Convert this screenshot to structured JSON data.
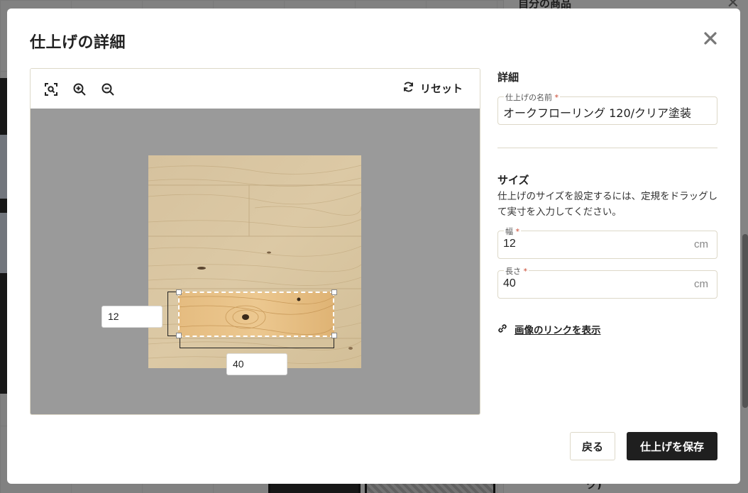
{
  "background": {
    "panel_title": "自分の商品",
    "fragment_text": "ク)"
  },
  "modal": {
    "title": "仕上げの詳細",
    "close_icon": "close-icon"
  },
  "editor": {
    "tools": [
      "fit-to-screen-icon",
      "zoom-in-icon",
      "zoom-out-icon"
    ],
    "reset_label": "リセット",
    "width_value": "12",
    "length_value": "40"
  },
  "details": {
    "heading": "詳細",
    "name_label": "仕上げの名前",
    "name_required": "*",
    "name_value": "オークフローリング 120/クリア塗装"
  },
  "size": {
    "heading": "サイズ",
    "help_text": "仕上げのサイズを設定するには、定規をドラッグして実寸を入力してください。",
    "width_label": "幅",
    "width_required": "*",
    "width_value": "12",
    "width_unit": "cm",
    "length_label": "長さ",
    "length_required": "*",
    "length_value": "40",
    "length_unit": "cm"
  },
  "link": {
    "icon": "link-icon",
    "label": "画像のリンクを表示"
  },
  "buttons": {
    "back_label": "戻る",
    "save_label": "仕上げを保存"
  },
  "colors": {
    "primary_button": "#1f1f1f",
    "required_marker": "#c8452d",
    "canvas_bg": "#9a9a9a",
    "border": "#ddd8c8"
  }
}
